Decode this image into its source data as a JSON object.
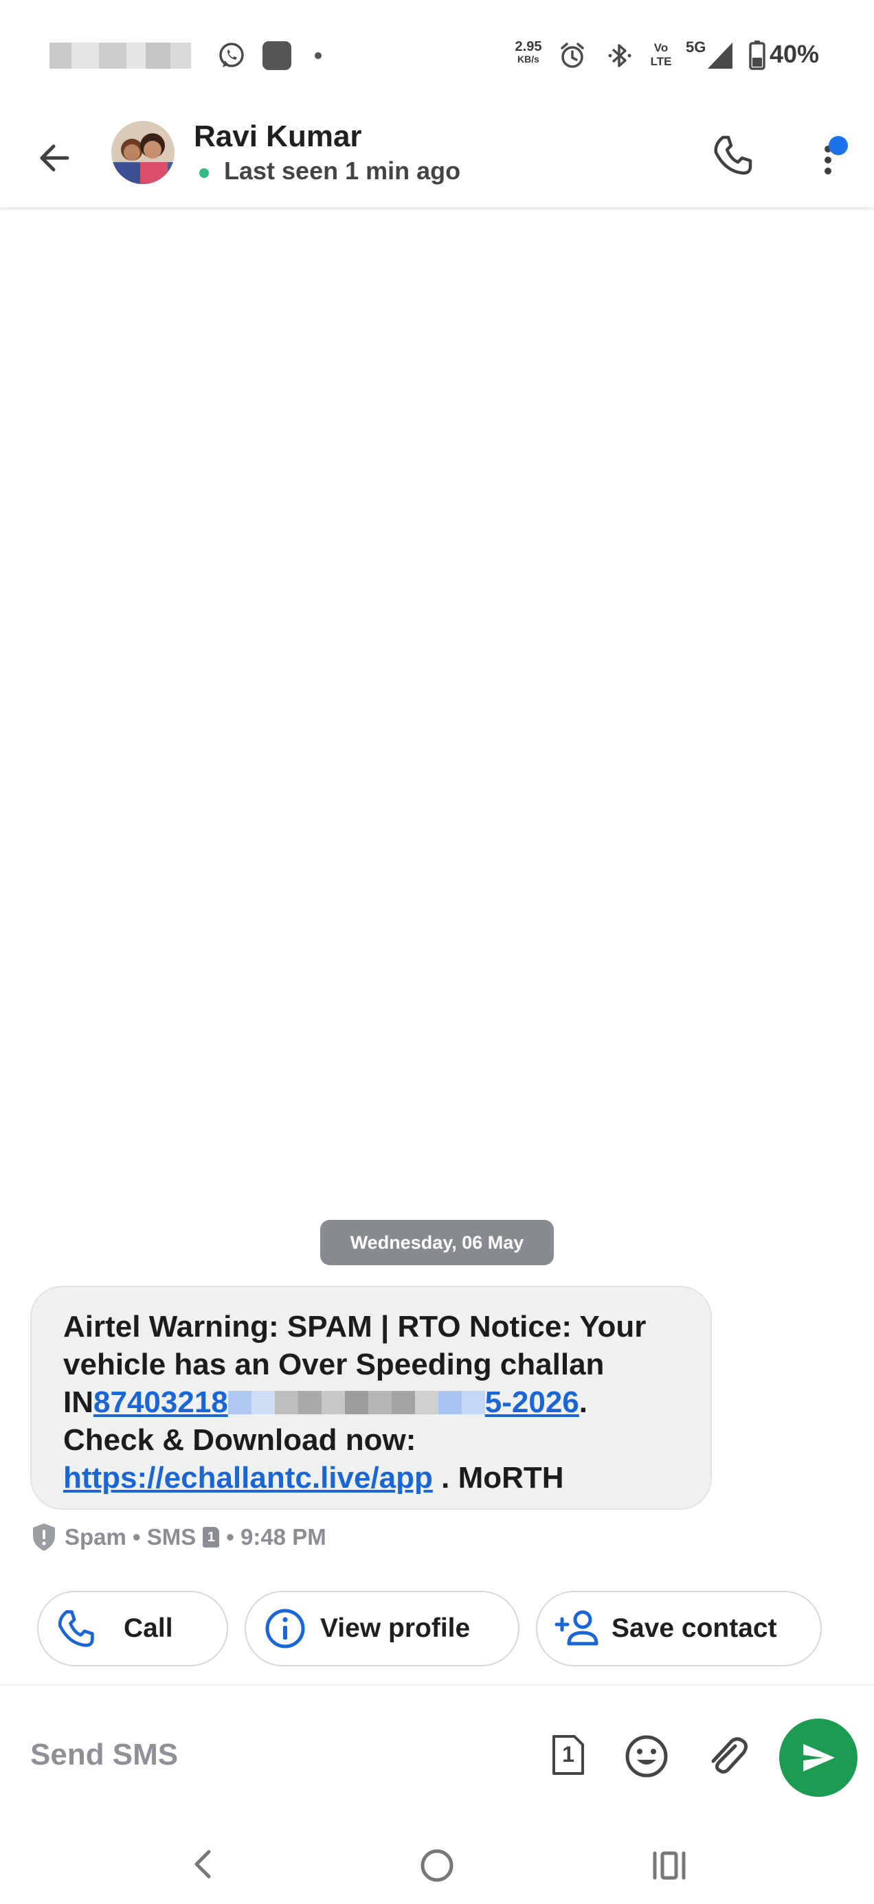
{
  "status_bar": {
    "net_speed_value": "2.95",
    "net_speed_unit": "KB/s",
    "volte_label_top": "Vo",
    "volte_label_bottom": "LTE",
    "network_type": "5G",
    "battery_percent": "40%"
  },
  "header": {
    "contact_name": "Ravi Kumar",
    "last_seen": "Last seen 1 min ago"
  },
  "conversation": {
    "date_separator": "Wednesday, 06 May",
    "message": {
      "line1": "Airtel Warning: SPAM | RTO Notice: Your",
      "line2": "vehicle has an Over Speeding challan",
      "challan_prefix": "IN",
      "challan_link_start": "87403218",
      "challan_link_end": "5-2026",
      "challan_suffix": ".",
      "line4": "Check & Download now:",
      "url": "https://echallantc.live/app",
      "url_suffix": " . MoRTH"
    },
    "meta": {
      "label": "Spam • SMS",
      "sim_number": "1",
      "time": "• 9:48 PM"
    }
  },
  "actions": {
    "call_label": "Call",
    "view_profile_label": "View profile",
    "save_contact_label": "Save contact"
  },
  "composer": {
    "placeholder": "Send SMS",
    "sim_number": "1"
  },
  "colors": {
    "accent_blue": "#1a66d6",
    "send_green": "#1a9b51",
    "online_green": "#2ebd85"
  }
}
